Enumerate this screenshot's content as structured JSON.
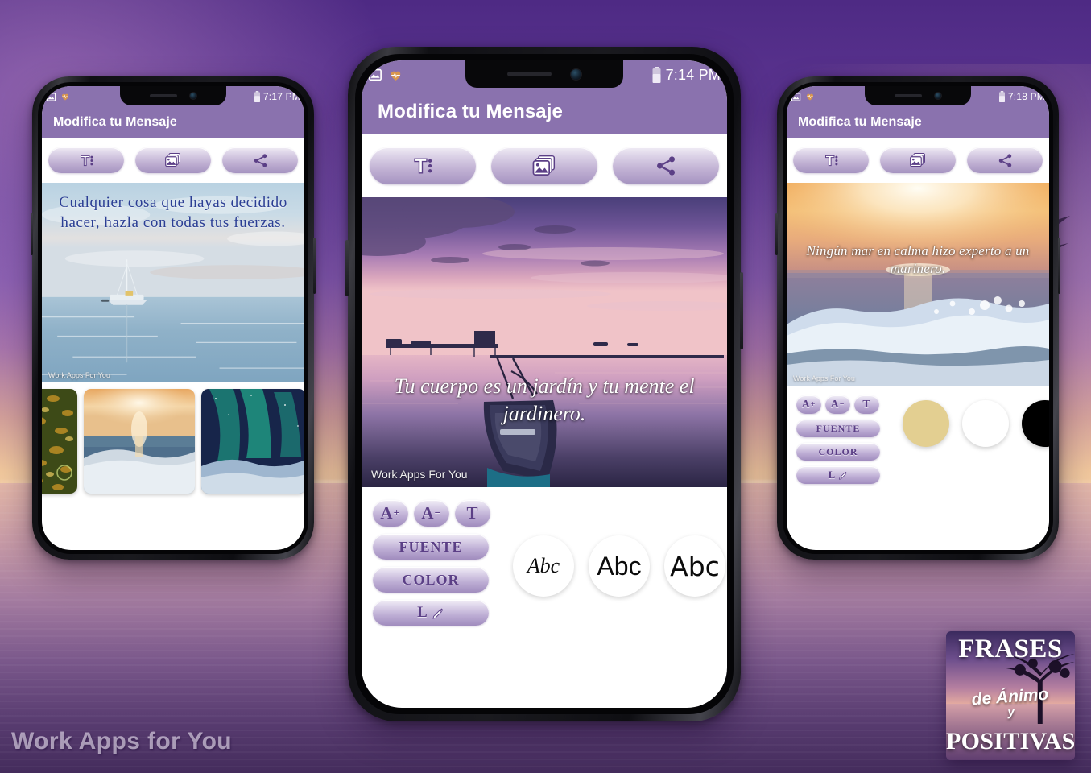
{
  "promo": {
    "watermark": "Work Apps for You",
    "logo": {
      "line1": "FRASES",
      "line2": "de Ánimo",
      "line3": "y",
      "line4": "POSITIVAS"
    },
    "background_colors": {
      "sky_top": "#4e2a84",
      "sky_mid": "#8258ad",
      "sunset": "#f6d3aa",
      "water": "#6b4a8c"
    }
  },
  "phones": [
    {
      "id": "left",
      "status": {
        "time": "7:17 PM",
        "icons": [
          "gallery-icon",
          "heart-icon",
          "battery-icon"
        ]
      },
      "appbar": {
        "title": "Modifica tu Mensaje"
      },
      "toolbar": [
        {
          "name": "text-tool-button",
          "icon": "text-format-icon"
        },
        {
          "name": "image-tool-button",
          "icon": "gallery-icon"
        },
        {
          "name": "share-tool-button",
          "icon": "share-icon"
        }
      ],
      "canvas": {
        "quote": "Cualquier cosa que hayas decidido hacer, hazla con todas tus fuerzas.",
        "quote_color": "#2b3e94",
        "watermark": "Work Apps For You"
      },
      "gallery": [
        {
          "name": "thumb-autumn-leaves"
        },
        {
          "name": "thumb-sunset-wave"
        },
        {
          "name": "thumb-aurora"
        }
      ]
    },
    {
      "id": "center",
      "status": {
        "time": "7:14 PM",
        "icons": [
          "gallery-icon",
          "heart-icon",
          "battery-icon"
        ]
      },
      "appbar": {
        "title": "Modifica tu Mensaje"
      },
      "toolbar": [
        {
          "name": "text-tool-button",
          "icon": "text-format-icon"
        },
        {
          "name": "image-tool-button",
          "icon": "gallery-icon"
        },
        {
          "name": "share-tool-button",
          "icon": "share-icon"
        }
      ],
      "canvas": {
        "quote": "Tu cuerpo es un jardín y tu mente el jardinero.",
        "quote_color": "#ffffff",
        "watermark": "Work Apps For You"
      },
      "editor": {
        "size_up": "A",
        "size_up_sign": "+",
        "size_down": "A",
        "size_down_sign": "−",
        "text_style": "T",
        "font_label": "FUENTE",
        "color_label": "COLOR",
        "align_label": "L",
        "font_options": [
          {
            "name": "font-option-script",
            "sample": "Abc"
          },
          {
            "name": "font-option-sans",
            "sample": "Abc"
          },
          {
            "name": "font-option-bold",
            "sample": "Abc"
          }
        ]
      }
    },
    {
      "id": "right",
      "status": {
        "time": "7:18 PM",
        "icons": [
          "gallery-icon",
          "heart-icon",
          "battery-icon"
        ]
      },
      "appbar": {
        "title": "Modifica tu Mensaje"
      },
      "toolbar": [
        {
          "name": "text-tool-button",
          "icon": "text-format-icon"
        },
        {
          "name": "image-tool-button",
          "icon": "gallery-icon"
        },
        {
          "name": "share-tool-button",
          "icon": "share-icon"
        }
      ],
      "canvas": {
        "quote": "Ningún mar en calma hizo experto a un marinero.",
        "quote_color": "#ffffff",
        "watermark": "Work Apps For You"
      },
      "editor": {
        "size_up": "A",
        "size_up_sign": "+",
        "size_down": "A",
        "size_down_sign": "−",
        "text_style": "T",
        "font_label": "FUENTE",
        "color_label": "COLOR",
        "align_label": "L",
        "color_options": [
          {
            "name": "color-swatch-gold",
            "hex": "#e3cf91"
          },
          {
            "name": "color-swatch-white",
            "hex": "#ffffff"
          },
          {
            "name": "color-swatch-black",
            "hex": "#000000"
          }
        ]
      }
    }
  ]
}
